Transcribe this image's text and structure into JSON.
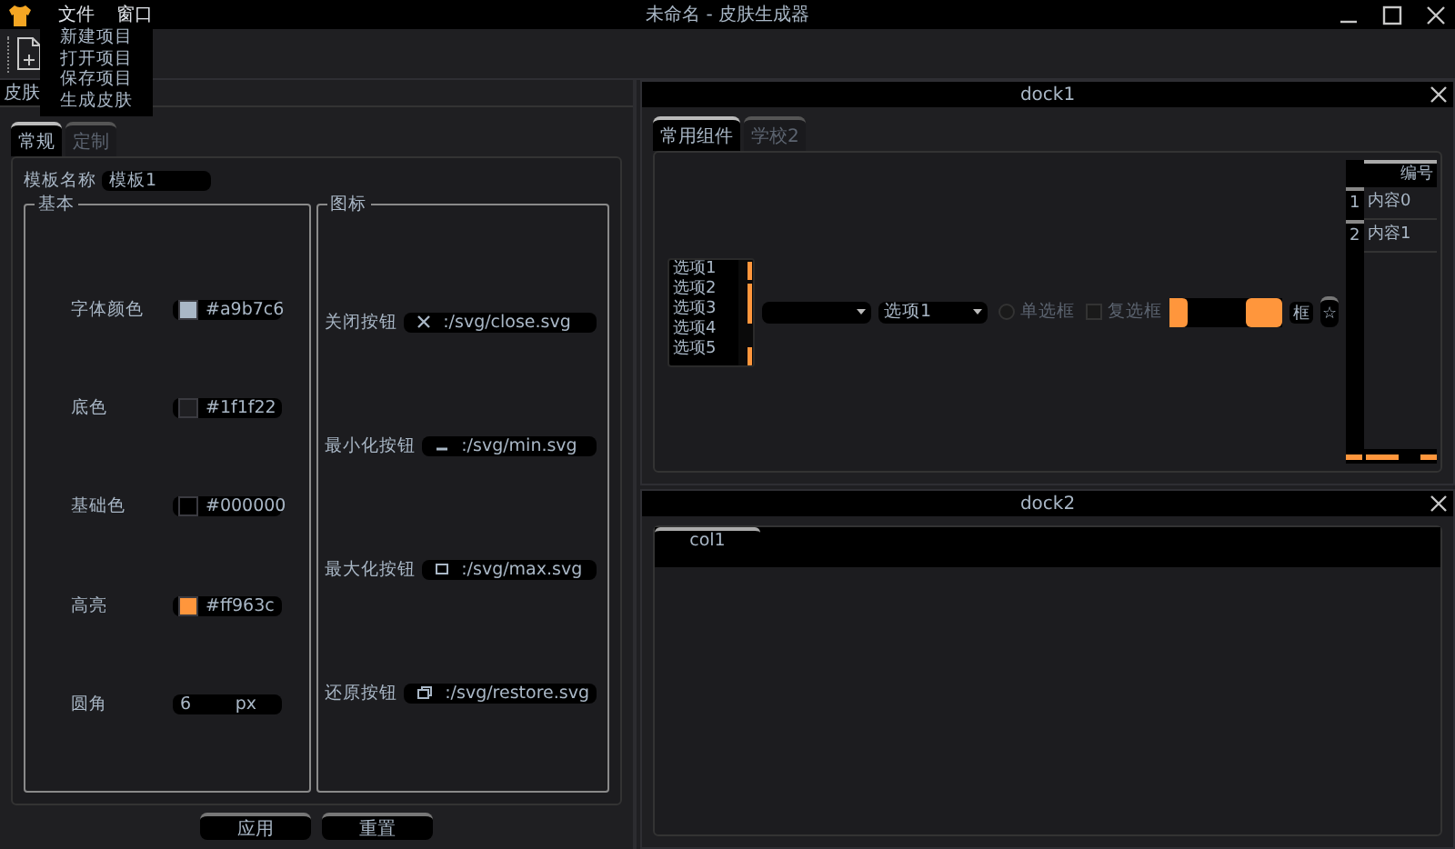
{
  "window": {
    "title": "未命名 - 皮肤生成器"
  },
  "menubar": [
    "文件",
    "窗口"
  ],
  "file_menu": [
    "新建项目",
    "打开项目",
    "保存项目",
    "生成皮肤"
  ],
  "main_tab": {
    "label": "皮肤",
    "selected": true
  },
  "editor": {
    "tabs": [
      {
        "label": "常规",
        "selected": true
      },
      {
        "label": "定制",
        "selected": false
      }
    ],
    "template_name": {
      "label": "模板名称",
      "value": "模板1"
    },
    "basic": {
      "title": "基本",
      "fields": [
        {
          "kind": "color",
          "label": "字体颜色",
          "value": "#a9b7c6",
          "color": "#a9b7c6"
        },
        {
          "kind": "color",
          "label": "底色",
          "value": "#1f1f22",
          "color": "#1f1f22"
        },
        {
          "kind": "color",
          "label": "基础色",
          "value": "#000000",
          "color": "#000000"
        },
        {
          "kind": "color",
          "label": "高亮",
          "value": "#ff963c",
          "color": "#ff963c"
        },
        {
          "kind": "number",
          "label": "圆角",
          "value": "6",
          "unit": "px"
        }
      ]
    },
    "icons": {
      "title": "图标",
      "fields": [
        {
          "kind": "close",
          "label": "关闭按钮",
          "value": ":/svg/close.svg"
        },
        {
          "kind": "min",
          "label": "最小化按钮",
          "value": ":/svg/min.svg"
        },
        {
          "kind": "max",
          "label": "最大化按钮",
          "value": ":/svg/max.svg"
        },
        {
          "kind": "restore",
          "label": "还原按钮",
          "value": ":/svg/restore.svg"
        }
      ]
    },
    "buttons": [
      "应用",
      "重置"
    ]
  },
  "dock1": {
    "title": "dock1",
    "tabs": [
      {
        "label": "常用组件",
        "selected": true
      },
      {
        "label": "学校2",
        "selected": false
      }
    ],
    "list": [
      "选项1",
      "选项2",
      "选项3",
      "选项4",
      "选项5"
    ],
    "combo_boxes": [
      {
        "kind": "empty"
      },
      {
        "kind": "filled",
        "value": "选项1"
      }
    ],
    "radio": {
      "label": "单选框",
      "checked": false
    },
    "checkbox": {
      "label": "复选框",
      "checked": false
    },
    "text_button": "框",
    "star_button": "☆",
    "table": {
      "columns": [
        "编号"
      ],
      "rows": [
        {
          "header": "1",
          "cells": [
            "内容0"
          ]
        },
        {
          "header": "2",
          "cells": [
            "内容1"
          ]
        }
      ]
    }
  },
  "dock2": {
    "title": "dock2",
    "table": {
      "columns": [
        "col1"
      ]
    }
  }
}
